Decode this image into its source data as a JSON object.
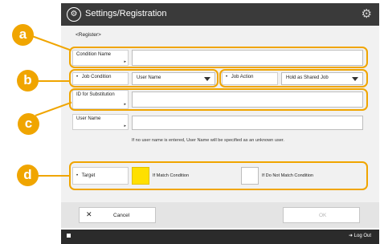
{
  "titlebar": {
    "title": "Settings/Registration",
    "app_icon": "settings-registration-icon",
    "gear_icon": "gear-icon"
  },
  "screen_label": "<Register>",
  "form": {
    "condition_name": {
      "label": "Condition Name",
      "value": ""
    },
    "job_condition": {
      "label": "Job Condition",
      "value": "User Name"
    },
    "job_action": {
      "label": "Job Action",
      "value": "Hold as Shared Job"
    },
    "id_for_substitution": {
      "label": "ID for Substitution",
      "value": ""
    },
    "user_name": {
      "label": "User Name",
      "value": ""
    },
    "hint": "If no user name is entered, User Name will be specified as an unknown user.",
    "target": {
      "label": "Target",
      "options": [
        {
          "label": "If Match Condition",
          "selected": true
        },
        {
          "label": "If Do Not Match Condition",
          "selected": false
        }
      ]
    }
  },
  "callouts": [
    "a",
    "b",
    "c",
    "d"
  ],
  "footer": {
    "cancel_icon": "x-icon",
    "cancel_label": "Cancel",
    "ok_label": "OK"
  },
  "statusbar": {
    "logout_label": "Log Out",
    "logout_icon": "logout-icon"
  },
  "colors": {
    "accent": "#f0a500",
    "selected": "#ffe000",
    "titlebar": "#3a3a3a"
  }
}
